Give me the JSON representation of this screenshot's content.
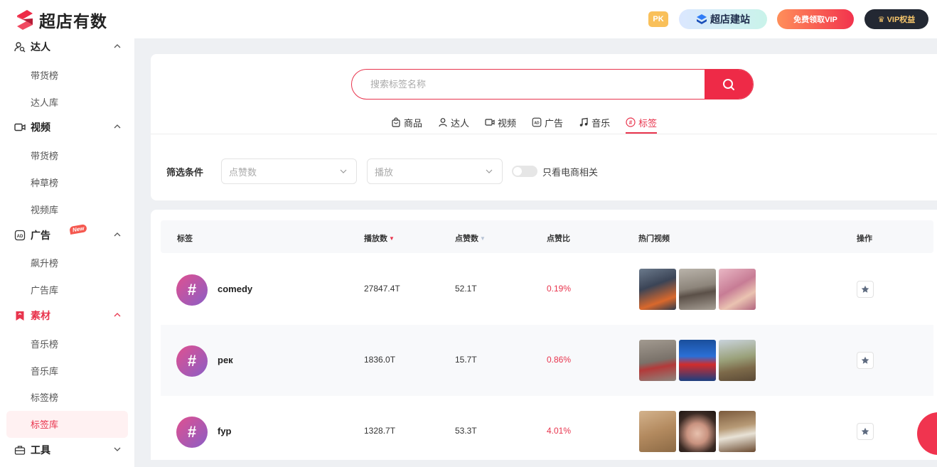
{
  "header": {
    "logo_text": "超店有数",
    "pk_label": "PK",
    "jianzhan_label": "超店建站",
    "free_vip_label": "免费领取VIP",
    "vip_rights_label": "VIP权益",
    "brand_color": "#e8344d"
  },
  "sidebar": {
    "sections": [
      {
        "label": "达人",
        "icon": "user-search-icon",
        "expanded": true,
        "items": [
          "带货榜",
          "达人库"
        ]
      },
      {
        "label": "视频",
        "icon": "video-icon",
        "expanded": true,
        "items": [
          "带货榜",
          "种草榜",
          "视频库"
        ]
      },
      {
        "label": "广告",
        "icon": "ad-icon",
        "badge": "New",
        "expanded": true,
        "items": [
          "飙升榜",
          "广告库"
        ]
      },
      {
        "label": "素材",
        "icon": "bookmark-icon",
        "expanded": true,
        "active": true,
        "items": [
          "音乐榜",
          "音乐库",
          "标签榜",
          "标签库"
        ]
      },
      {
        "label": "工具",
        "icon": "toolbox-icon",
        "expanded": false,
        "items": []
      }
    ],
    "selected_item": "标签库"
  },
  "search": {
    "placeholder": "搜索标签名称",
    "button_icon": "search-icon"
  },
  "tabs": [
    {
      "label": "商品",
      "icon": "bag-icon"
    },
    {
      "label": "达人",
      "icon": "person-icon"
    },
    {
      "label": "视频",
      "icon": "video-icon"
    },
    {
      "label": "广告",
      "icon": "ad-icon"
    },
    {
      "label": "音乐",
      "icon": "music-icon"
    },
    {
      "label": "标签",
      "icon": "tag-icon",
      "active": true
    }
  ],
  "filters": {
    "label": "筛选条件",
    "likes_placeholder": "点赞数",
    "plays_placeholder": "播放",
    "toggle_label": "只看电商相关",
    "toggle_on": false
  },
  "table": {
    "columns": [
      "标签",
      "播放数",
      "点赞数",
      "点赞比",
      "热门视频",
      "操作"
    ],
    "sort": {
      "column": "播放数",
      "direction": "desc"
    },
    "rows": [
      {
        "tag": "comedy",
        "plays": "27847.4T",
        "likes": "52.1T",
        "ratio": "0.19%"
      },
      {
        "tag": "рек",
        "plays": "1836.0T",
        "likes": "15.7T",
        "ratio": "0.86%"
      },
      {
        "tag": "fyp",
        "plays": "1328.7T",
        "likes": "53.3T",
        "ratio": "4.01%"
      }
    ]
  }
}
